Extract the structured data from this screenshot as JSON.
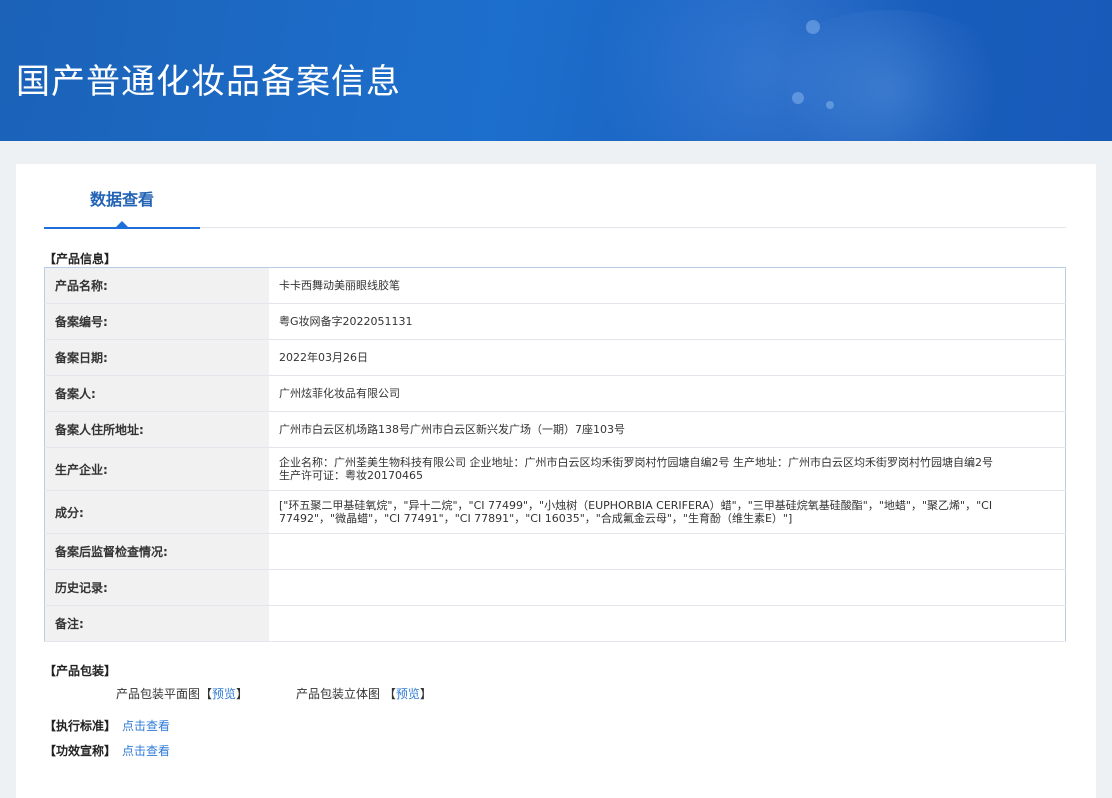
{
  "header": {
    "title": "国产普通化妆品备案信息"
  },
  "tab": {
    "label": "数据查看"
  },
  "product_section": {
    "title": "【产品信息】"
  },
  "product_info": [
    {
      "label": "产品名称:",
      "value": "卡卡西舞动美丽眼线胶笔"
    },
    {
      "label": "备案编号:",
      "value": "粤G妆网备字2022051131"
    },
    {
      "label": "备案日期:",
      "value": "2022年03月26日"
    },
    {
      "label": "备案人:",
      "value": "广州炫菲化妆品有限公司"
    },
    {
      "label": "备案人住所地址:",
      "value": "广州市白云区机场路138号广州市白云区新兴发广场（一期）7座103号"
    },
    {
      "label": "生产企业:",
      "value": "企业名称：广州荃美生物科技有限公司 企业地址：广州市白云区均禾街罗岗村竹园塘自编2号 生产地址：广州市白云区均禾街罗岗村竹园塘自编2号 生产许可证：粤妆20170465"
    },
    {
      "label": "成分:",
      "value": "[\"环五聚二甲基硅氧烷\"，\"异十二烷\"，\"CI 77499\"，\"小烛树（EUPHORBIA CERIFERA）蜡\"，\"三甲基硅烷氧基硅酸酯\"，\"地蜡\"，\"聚乙烯\"，\"CI 77492\"，\"微晶蜡\"，\"CI 77491\"，\"CI 77891\"，\"CI 16035\"，\"合成氟金云母\"，\"生育酚（维生素E）\"]"
    },
    {
      "label": "备案后监督检查情况:",
      "value": ""
    },
    {
      "label": "历史记录:",
      "value": ""
    },
    {
      "label": "备注:",
      "value": ""
    }
  ],
  "packaging": {
    "title": "【产品包装】",
    "flat_label": "产品包装平面图",
    "solid_label": "产品包装立体图",
    "bracket_open": "【",
    "bracket_close": "】",
    "preview": "预览"
  },
  "standard": {
    "label": "【执行标准】",
    "link": "点击查看"
  },
  "efficacy": {
    "label": "【功效宣称】",
    "link": "点击查看"
  }
}
